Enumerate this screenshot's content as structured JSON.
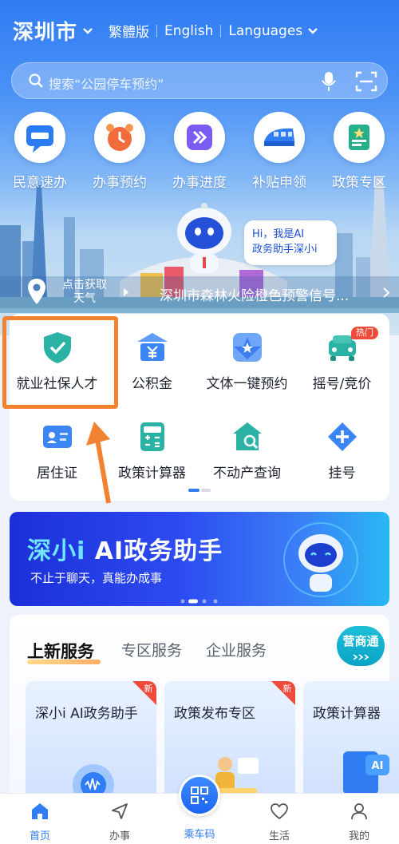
{
  "header": {
    "city": "深圳市",
    "lang_traditional": "繁體版",
    "lang_english": "English",
    "lang_languages": "Languages"
  },
  "search": {
    "placeholder": "搜索“公园停车预约”"
  },
  "quick_actions": [
    {
      "label": "民意速办",
      "icon": "feedback-icon"
    },
    {
      "label": "办事预约",
      "icon": "alarm-clock-icon"
    },
    {
      "label": "办事进度",
      "icon": "progress-icon"
    },
    {
      "label": "补贴申领",
      "icon": "train-icon"
    },
    {
      "label": "政策专区",
      "icon": "policy-book-icon"
    }
  ],
  "assistant": {
    "greeting_line1": "Hi，我是AI",
    "greeting_line2": "政务助手深小i"
  },
  "weather": {
    "line1": "点击获取",
    "line2": "天气"
  },
  "notice": "深圳市森林火险橙色预警信号...",
  "services": [
    {
      "label": "就业社保人才",
      "icon": "shield-check-icon"
    },
    {
      "label": "公积金",
      "icon": "fund-yen-icon"
    },
    {
      "label": "文体一键预约",
      "icon": "star-tile-icon"
    },
    {
      "label": "摇号/竞价",
      "icon": "car-icon",
      "badge": "热门"
    },
    {
      "label": "居住证",
      "icon": "id-card-icon"
    },
    {
      "label": "政策计算器",
      "icon": "calculator-icon"
    },
    {
      "label": "不动产查询",
      "icon": "house-search-icon"
    },
    {
      "label": "挂号",
      "icon": "medical-plus-icon"
    }
  ],
  "banner": {
    "title_accent": "深小i ",
    "title_rest": "AI政务助手",
    "subtitle": "不止于聊天，真能办成事"
  },
  "tabs": {
    "items": [
      "上新服务",
      "专区服务",
      "企业服务"
    ],
    "active": "上新服务",
    "yingshangtong": "营商通"
  },
  "new_cards": [
    {
      "title": "深小i AI政务助手",
      "tag": "新"
    },
    {
      "title": "政策发布专区",
      "tag": "新"
    },
    {
      "title": "政策计算器"
    }
  ],
  "bottom_nav": [
    {
      "label": "首页",
      "icon": "home-icon"
    },
    {
      "label": "办事",
      "icon": "send-icon"
    },
    {
      "label": "乘车码",
      "icon": "bus-code-icon"
    },
    {
      "label": "生活",
      "icon": "heart-icon"
    },
    {
      "label": "我的",
      "icon": "user-icon"
    }
  ],
  "colors": {
    "primary": "#2f7cf3",
    "highlight_box": "#f2822f",
    "hot_badge": "#ef4a3a",
    "teal": "#1ec0d8"
  }
}
